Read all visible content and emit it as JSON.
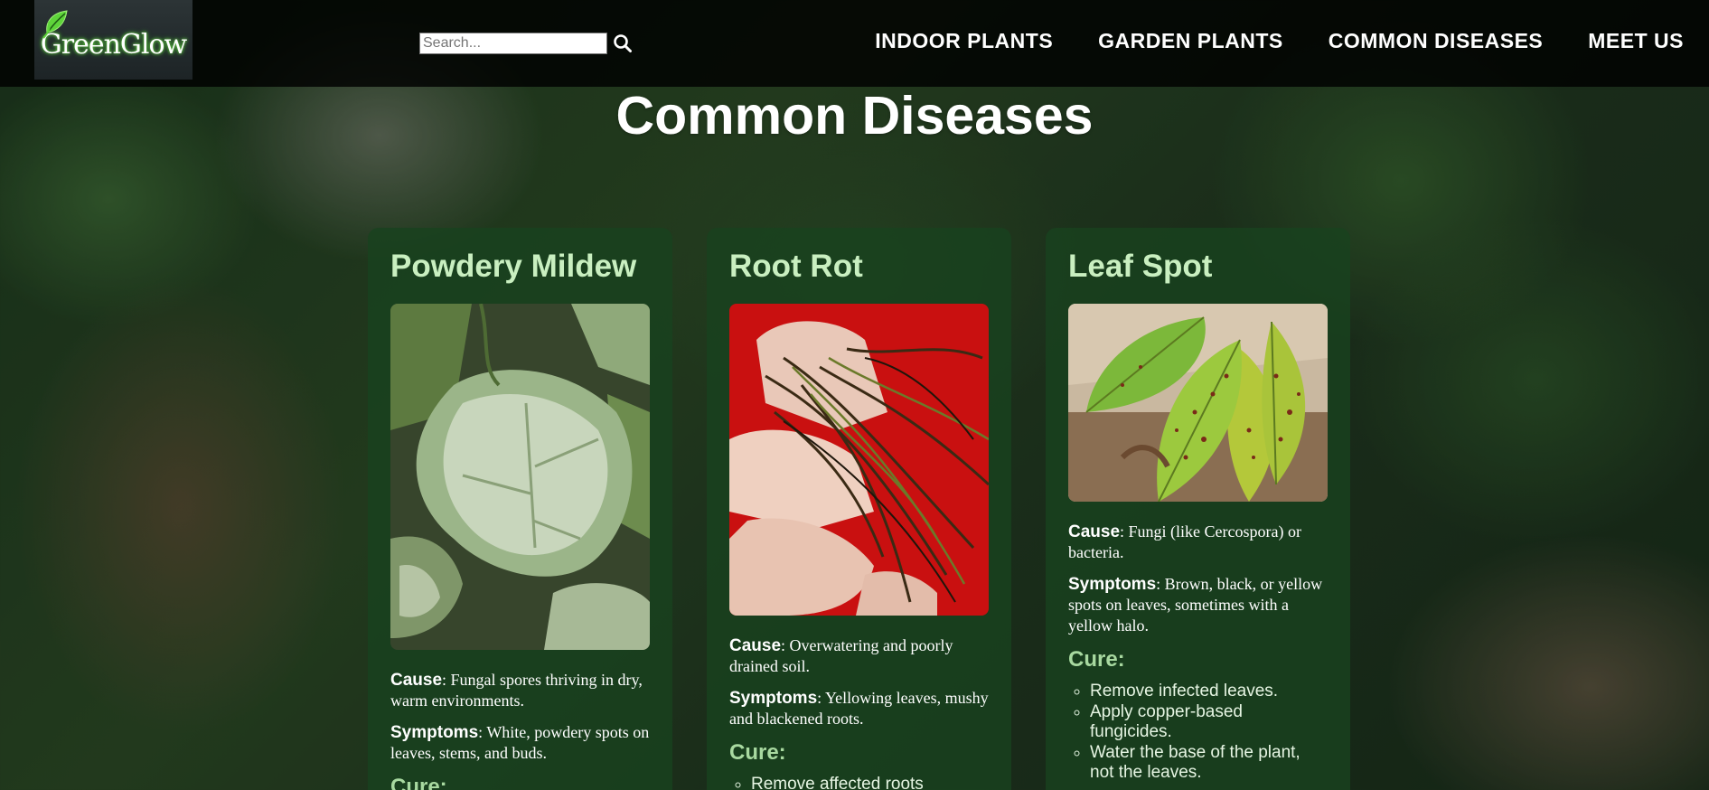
{
  "brand": {
    "logo_text": "GreenGlow"
  },
  "search": {
    "placeholder": "Search..."
  },
  "nav": {
    "items": [
      "INDOOR PLANTS",
      "GARDEN PLANTS",
      "COMMON DISEASES",
      "MEET US"
    ]
  },
  "page": {
    "title": "Common Diseases"
  },
  "labels": {
    "cause": "Cause",
    "symptoms": "Symptoms",
    "cure": "Cure:"
  },
  "diseases": [
    {
      "name": "Powdery Mildew",
      "image_icon": "powdery-mildew-leaf-photo",
      "cause": ": Fungal spores thriving in dry, warm environments.",
      "symptoms": ": White, powdery spots on leaves, stems, and buds.",
      "cure_heading": "Cure:",
      "cure_items": []
    },
    {
      "name": "Root Rot",
      "image_icon": "rotting-roots-photo",
      "cause": ": Overwatering and poorly drained soil.",
      "symptoms": ": Yellowing leaves, mushy and blackened roots.",
      "cure_heading": "Cure:",
      "cure_items": [
        "Remove affected roots"
      ]
    },
    {
      "name": "Leaf Spot",
      "image_icon": "spotted-leaves-photo",
      "cause": ": Fungi (like Cercospora) or bacteria.",
      "symptoms": ": Brown, black, or yellow spots on leaves, sometimes with a yellow halo.",
      "cure_heading": "Cure:",
      "cure_items": [
        "Remove infected leaves.",
        "Apply copper-based fungicides.",
        "Water the base of the plant, not the leaves."
      ]
    }
  ],
  "colors": {
    "nav_bg": "#000000",
    "card_bg": "#18421e",
    "card_title": "#c9efc0",
    "cure_heading": "#a8d9a0"
  }
}
